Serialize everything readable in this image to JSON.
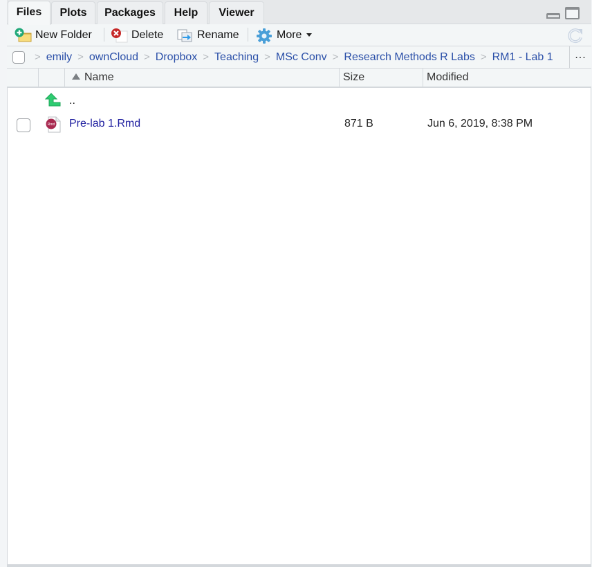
{
  "tabs": [
    {
      "label": "Files",
      "active": true
    },
    {
      "label": "Plots",
      "active": false
    },
    {
      "label": "Packages",
      "active": false
    },
    {
      "label": "Help",
      "active": false
    },
    {
      "label": "Viewer",
      "active": false
    }
  ],
  "toolbar": {
    "new_folder": {
      "label": "New Folder",
      "icon": "new-folder-icon"
    },
    "delete": {
      "label": "Delete",
      "icon": "delete-icon"
    },
    "rename": {
      "label": "Rename",
      "icon": "rename-icon"
    },
    "more": {
      "label": "More",
      "icon": "gear-icon"
    },
    "refresh_icon": "refresh-icon"
  },
  "breadcrumb": {
    "items": [
      "emily",
      "ownCloud",
      "Dropbox",
      "Teaching",
      "MSc Conv",
      "Research Methods R Labs",
      "RM1 - Lab 1"
    ],
    "separator": ">",
    "overflow_label": "..."
  },
  "columns": {
    "name": "Name",
    "size": "Size",
    "modified": "Modified",
    "sort": "name-ascending"
  },
  "files": [
    {
      "type": "parent",
      "name": "..",
      "size": "",
      "modified": "",
      "icon": "up-arrow-icon"
    },
    {
      "type": "rmd",
      "name": "Pre-lab 1.Rmd",
      "size": "871 B",
      "modified": "Jun 6, 2019, 8:38 PM",
      "icon": "rmd-file-icon",
      "checked": false
    }
  ],
  "colors": {
    "link": "#2a4fa8",
    "file_link": "#2020a0",
    "up_arrow": "#2ecc71",
    "rmd_badge": "#a8284f"
  }
}
